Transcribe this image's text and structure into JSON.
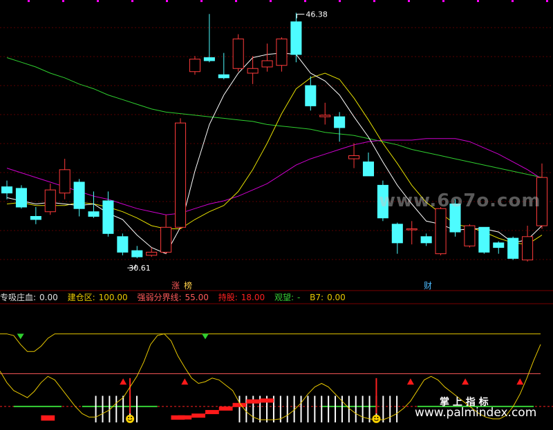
{
  "price_labels": {
    "high": "46.38",
    "low": "30.61"
  },
  "event_tags": {
    "limit_up": "涨",
    "dragon_list": "榜",
    "finance": "财"
  },
  "indicator_line": {
    "name": "专吸庄血:",
    "name_value": "0.00",
    "items": [
      {
        "label": "建仓区:",
        "value": "100.00",
        "color": "#e8c800"
      },
      {
        "label": "强弱分界线:",
        "value": "55.00",
        "color": "#ff5a5a"
      },
      {
        "label": "持股:",
        "value": "18.00",
        "color": "#ff2020"
      },
      {
        "label": "观望:",
        "value": "-",
        "color": "#36d136"
      },
      {
        "label": "B7:",
        "value": "0.00",
        "color": "#e8c800"
      }
    ]
  },
  "watermarks": {
    "site": "www.6o7o.com",
    "brand_cn": "掌 上 指 标",
    "brand_url": "www.palmindex.com"
  },
  "colors": {
    "up": "#ff3b3b",
    "down": "#4dfcff",
    "ma5": "#ffffff",
    "ma10": "#e6e000",
    "ma30": "#d000d0",
    "ma60": "#2fcf2f",
    "grid": "#5a0000",
    "bg": "#000000"
  },
  "chart_data": {
    "type": "candlestick",
    "y_range": [
      28.8,
      47.2
    ],
    "marked_high": 46.38,
    "marked_low": 30.61,
    "candles": [
      {
        "o": 35.2,
        "h": 35.6,
        "l": 34.4,
        "c": 34.8
      },
      {
        "o": 35.1,
        "h": 35.3,
        "l": 33.8,
        "c": 33.9
      },
      {
        "o": 33.3,
        "h": 33.9,
        "l": 32.8,
        "c": 33.1
      },
      {
        "o": 33.6,
        "h": 35.4,
        "l": 33.4,
        "c": 35.0
      },
      {
        "o": 34.8,
        "h": 37.0,
        "l": 34.4,
        "c": 36.3
      },
      {
        "o": 35.5,
        "h": 35.7,
        "l": 33.3,
        "c": 33.8
      },
      {
        "o": 33.6,
        "h": 34.9,
        "l": 33.2,
        "c": 33.3
      },
      {
        "o": 34.3,
        "h": 34.9,
        "l": 32.0,
        "c": 32.2
      },
      {
        "o": 32.0,
        "h": 32.2,
        "l": 30.8,
        "c": 31.0
      },
      {
        "o": 31.1,
        "h": 31.4,
        "l": 30.61,
        "c": 30.7
      },
      {
        "o": 30.8,
        "h": 31.3,
        "l": 30.7,
        "c": 31.0
      },
      {
        "o": 31.0,
        "h": 33.4,
        "l": 30.9,
        "c": 32.6
      },
      {
        "o": 32.6,
        "h": 39.6,
        "l": 32.5,
        "c": 39.3
      },
      {
        "o": 42.6,
        "h": 43.6,
        "l": 42.4,
        "c": 43.4
      },
      {
        "o": 43.5,
        "h": 46.3,
        "l": 43.2,
        "c": 43.3
      },
      {
        "o": 42.4,
        "h": 43.8,
        "l": 42.1,
        "c": 42.2
      },
      {
        "o": 42.8,
        "h": 45.0,
        "l": 42.6,
        "c": 44.7
      },
      {
        "o": 42.5,
        "h": 43.6,
        "l": 41.8,
        "c": 42.8
      },
      {
        "o": 42.9,
        "h": 44.4,
        "l": 42.6,
        "c": 43.3
      },
      {
        "o": 43.0,
        "h": 44.8,
        "l": 42.6,
        "c": 44.7
      },
      {
        "o": 45.8,
        "h": 46.38,
        "l": 43.2,
        "c": 43.7
      },
      {
        "o": 41.7,
        "h": 42.3,
        "l": 40.1,
        "c": 40.4
      },
      {
        "o": 39.7,
        "h": 40.6,
        "l": 39.2,
        "c": 39.8
      },
      {
        "o": 39.7,
        "h": 40.0,
        "l": 38.1,
        "c": 39.0
      },
      {
        "o": 37.0,
        "h": 38.0,
        "l": 36.4,
        "c": 37.2
      },
      {
        "o": 36.8,
        "h": 37.4,
        "l": 35.9,
        "c": 35.9
      },
      {
        "o": 35.3,
        "h": 35.6,
        "l": 33.0,
        "c": 33.2
      },
      {
        "o": 32.8,
        "h": 32.9,
        "l": 30.9,
        "c": 31.6
      },
      {
        "o": 32.5,
        "h": 33.0,
        "l": 31.5,
        "c": 32.5
      },
      {
        "o": 32.0,
        "h": 32.2,
        "l": 31.4,
        "c": 31.6
      },
      {
        "o": 30.9,
        "h": 33.9,
        "l": 30.8,
        "c": 33.8
      },
      {
        "o": 34.1,
        "h": 34.4,
        "l": 32.0,
        "c": 32.3
      },
      {
        "o": 31.4,
        "h": 32.8,
        "l": 31.3,
        "c": 32.7
      },
      {
        "o": 32.6,
        "h": 32.6,
        "l": 30.9,
        "c": 31.0
      },
      {
        "o": 31.6,
        "h": 31.7,
        "l": 30.9,
        "c": 31.3
      },
      {
        "o": 31.9,
        "h": 32.0,
        "l": 30.5,
        "c": 30.6
      },
      {
        "o": 30.5,
        "h": 32.7,
        "l": 30.4,
        "c": 32.0
      },
      {
        "o": 32.7,
        "h": 36.7,
        "l": 32.5,
        "c": 35.8
      }
    ],
    "ma5": [
      34.5,
      34.3,
      34.1,
      34.2,
      34.1,
      34.0,
      34.1,
      33.5,
      33.1,
      32.1,
      31.3,
      30.9,
      32.6,
      36.2,
      39.2,
      41.1,
      42.5,
      43.5,
      43.7,
      43.8,
      43.7,
      42.5,
      42.0,
      41.1,
      39.7,
      38.4,
      36.8,
      35.3,
      34.1,
      33.0,
      32.8,
      32.4,
      32.5,
      32.5,
      32.3,
      31.6,
      31.8,
      32.7
    ],
    "ma10": [
      34.1,
      34.2,
      34.0,
      34.0,
      34.0,
      34.2,
      34.1,
      33.9,
      33.6,
      33.2,
      32.7,
      32.5,
      32.5,
      33.1,
      33.6,
      34.0,
      34.9,
      36.3,
      38.0,
      39.9,
      41.5,
      42.2,
      42.5,
      42.1,
      40.9,
      39.5,
      38.0,
      36.7,
      35.3,
      34.2,
      33.5,
      32.8,
      32.6,
      32.3,
      31.9,
      31.6,
      31.5,
      32.1
    ],
    "ma30": [
      36.4,
      36.1,
      35.8,
      35.5,
      35.2,
      34.9,
      34.6,
      34.4,
      34.1,
      33.8,
      33.6,
      33.4,
      33.5,
      33.8,
      34.1,
      34.3,
      34.6,
      35.0,
      35.4,
      36.0,
      36.6,
      37.0,
      37.3,
      37.6,
      37.9,
      38.1,
      38.2,
      38.2,
      38.2,
      38.3,
      38.3,
      38.3,
      38.1,
      37.7,
      37.3,
      36.8,
      36.3,
      35.7
    ],
    "ma60": [
      43.5,
      43.2,
      42.9,
      42.5,
      42.2,
      41.8,
      41.5,
      41.1,
      40.8,
      40.5,
      40.2,
      40.0,
      39.9,
      39.8,
      39.7,
      39.6,
      39.5,
      39.4,
      39.2,
      39.1,
      39.0,
      38.9,
      38.7,
      38.6,
      38.5,
      38.3,
      38.1,
      37.9,
      37.6,
      37.4,
      37.2,
      37.0,
      36.8,
      36.6,
      36.4,
      36.2,
      36.0,
      35.8
    ],
    "indicator": {
      "y_range": [
        0,
        120
      ],
      "upper_line": [
        100,
        100,
        98,
        88,
        80,
        80,
        86,
        95,
        100,
        100,
        100,
        100,
        100,
        100,
        100,
        100,
        100,
        100,
        100,
        100,
        100,
        100,
        100,
        100,
        100,
        100,
        100,
        100,
        100,
        100,
        100,
        100,
        100,
        100,
        100,
        100,
        100,
        100,
        100,
        100,
        100,
        100,
        100,
        100,
        100,
        100,
        100,
        100,
        100,
        100,
        100,
        100,
        100,
        100,
        100,
        100,
        100,
        100,
        100,
        100,
        100,
        100,
        100,
        100,
        100,
        100,
        100,
        100,
        100,
        100,
        100,
        100,
        100,
        100,
        100,
        100,
        100,
        100,
        100,
        100
      ],
      "oscillator": [
        58,
        45,
        36,
        32,
        28,
        35,
        45,
        52,
        48,
        38,
        28,
        18,
        10,
        6,
        6,
        10,
        14,
        22,
        28,
        40,
        52,
        68,
        88,
        98,
        100,
        92,
        75,
        62,
        50,
        44,
        46,
        50,
        48,
        42,
        36,
        22,
        12,
        6,
        3,
        3,
        3,
        4,
        8,
        14,
        22,
        32,
        40,
        44,
        40,
        32,
        24,
        16,
        10,
        6,
        4,
        3,
        3,
        6,
        10,
        16,
        24,
        36,
        48,
        52,
        48,
        40,
        34,
        28,
        22,
        16,
        10,
        6,
        4,
        4,
        8,
        18,
        32,
        50,
        70,
        88
      ],
      "strong_weak": 55.0,
      "hold": 18.0,
      "watch_segments": [
        [
          2,
          9
        ],
        [
          12,
          23
        ],
        [
          47,
          55
        ],
        [
          61,
          78
        ]
      ],
      "red_blocks": [
        [
          6,
          8,
          8,
          2
        ],
        [
          25,
          27,
          8,
          3
        ],
        [
          26,
          28,
          4,
          8
        ],
        [
          28,
          30,
          8,
          10
        ],
        [
          30,
          32,
          12,
          14
        ],
        [
          32,
          34,
          16,
          18
        ],
        [
          34,
          36,
          20,
          22
        ],
        [
          36,
          38,
          24,
          26
        ],
        [
          38,
          40,
          26,
          27
        ]
      ],
      "buy_triangles": [
        18,
        27,
        60,
        68,
        76
      ],
      "down_triangles": [
        3,
        30
      ],
      "white_bars": [
        14,
        15,
        16,
        17,
        18,
        19,
        20,
        35,
        36,
        37,
        38,
        39,
        40,
        41,
        42,
        43,
        44,
        45,
        46,
        47,
        48,
        49,
        50,
        51,
        52,
        53,
        54,
        55,
        56,
        57,
        58
      ],
      "smiley": [
        19,
        55
      ],
      "spikes": [
        19,
        55
      ]
    }
  }
}
